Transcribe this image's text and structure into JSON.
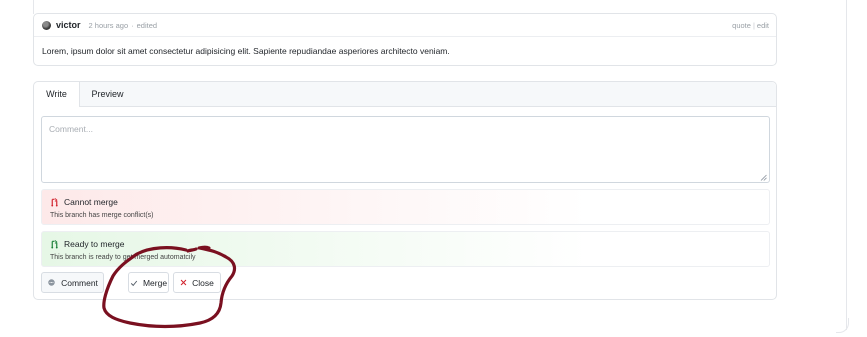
{
  "comment": {
    "author": "victor",
    "timestamp": "2 hours ago",
    "edited_label": "edited",
    "meta_separator": "·",
    "actions": {
      "quote": "quote",
      "separator": "|",
      "edit": "edit"
    },
    "body": "Lorem, ipsum dolor sit amet consectetur adipisicing elit. Sapiente repudiandae asperiores architecto veniam."
  },
  "editor": {
    "tabs": [
      {
        "label": "Write",
        "active": true
      },
      {
        "label": "Preview",
        "active": false
      }
    ],
    "placeholder": "Comment..."
  },
  "merge_status": {
    "conflict": {
      "title": "Cannot merge",
      "description": "This branch has merge conflict(s)",
      "color": "#d1242f",
      "icon": "merge-conflict-icon"
    },
    "ready": {
      "title": "Ready to merge",
      "description": "This branch is ready to get merged automatcily",
      "color": "#1a7f37",
      "icon": "merge-ready-icon"
    }
  },
  "buttons": {
    "comment": {
      "label": "Comment",
      "icon": "comment-icon"
    },
    "merge": {
      "label": "Merge",
      "icon": "check-icon"
    },
    "close": {
      "label": "Close",
      "icon": "close-x-icon"
    }
  },
  "annotation": {
    "color": "#7a1020",
    "icon": "hand-drawn-circle"
  }
}
